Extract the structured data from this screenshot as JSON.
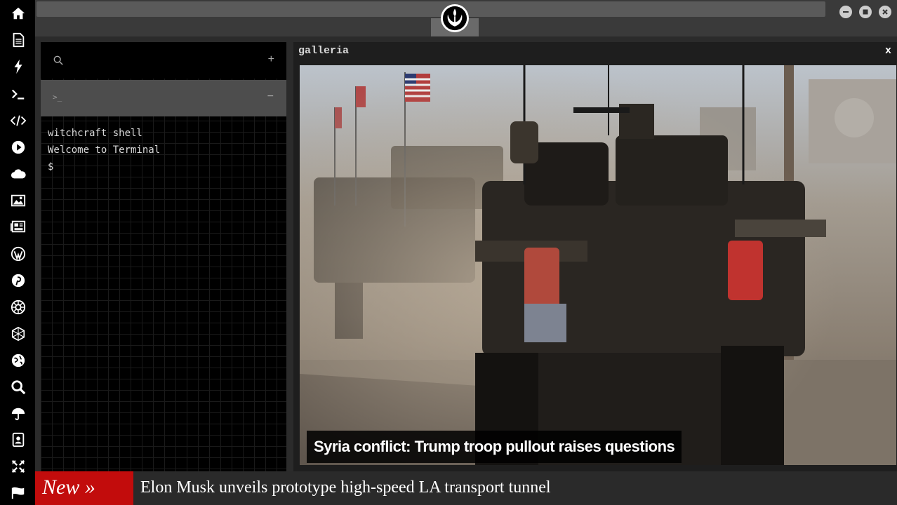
{
  "rail": {
    "icons": [
      "home-icon",
      "document-icon",
      "bolt-icon",
      "terminal-icon",
      "code-icon",
      "play-icon",
      "cloud-icon",
      "image-icon",
      "newspaper-icon",
      "wordpress-icon",
      "pinterest-icon",
      "galactic-empire-icon",
      "hexagon-icon",
      "globe-icon",
      "search-icon",
      "umbrella-icon",
      "contacts-icon",
      "expand-icon",
      "flag-icon"
    ]
  },
  "terminal": {
    "search_icon": "search-icon",
    "add_label": "+",
    "tab_prompt": ">_",
    "collapse_label": "−",
    "lines": [
      "witchcraft shell",
      "Welcome to Terminal",
      "$"
    ]
  },
  "gallery": {
    "title": "galleria",
    "close_label": "x",
    "caption": "Syria conflict: Trump troop pullout raises questions"
  },
  "ticker": {
    "label": "New »",
    "headline": "Elon Musk unveils prototype high-speed LA transport tunnel"
  },
  "colors": {
    "ticker_label_bg": "#c20c0c",
    "rail_bg": "#000000",
    "app_bg": "#2b2b2b"
  }
}
